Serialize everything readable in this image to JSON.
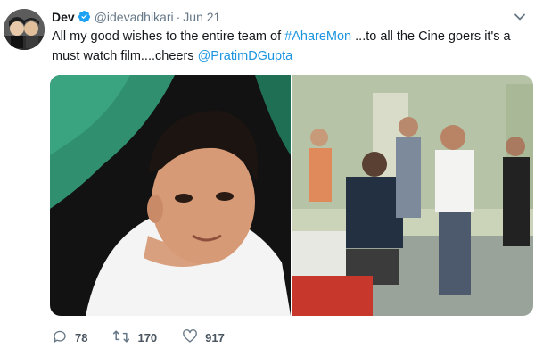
{
  "tweet": {
    "name": "Dev",
    "handle": "@idevadhikari",
    "separator": "·",
    "date": "Jun 21",
    "text_parts": {
      "p1": "All my good wishes to the entire team of ",
      "hashtag": "#AhareMon",
      "p2": " ...to all the Cine goers it's a must watch film....cheers ",
      "mention": "@PratimDGupta"
    },
    "accent_color": "#1b95e0"
  },
  "media": [
    {
      "icon": "photo-portrait",
      "description_hidden": true
    },
    {
      "icon": "photo-film-set",
      "description_hidden": true
    }
  ],
  "actions": {
    "reply_count": "78",
    "retweet_count": "170",
    "like_count": "917"
  }
}
